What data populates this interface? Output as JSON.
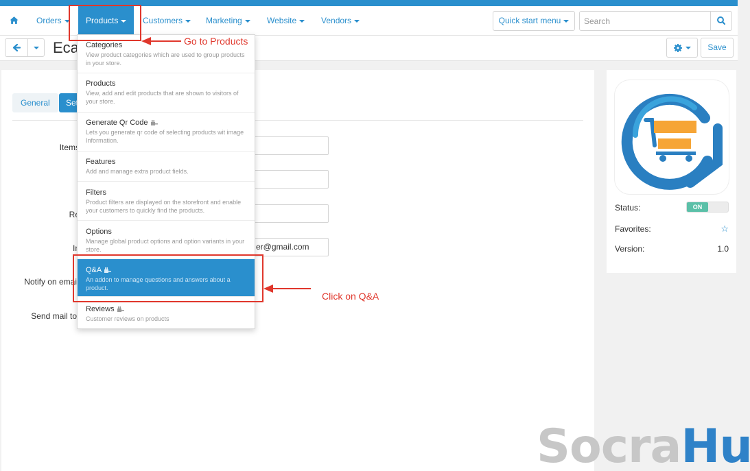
{
  "nav": {
    "items": [
      {
        "label": "Orders"
      },
      {
        "label": "Products"
      },
      {
        "label": "Customers"
      },
      {
        "label": "Marketing"
      },
      {
        "label": "Website"
      },
      {
        "label": "Vendors"
      }
    ],
    "quick_start_label": "Quick start menu",
    "search_placeholder": "Search"
  },
  "toolbar": {
    "title": "Eca",
    "save_label": "Save"
  },
  "tabs": [
    "General",
    "Set"
  ],
  "form": {
    "labels": [
      "Items",
      "Re",
      "In",
      "Notify on emai",
      "Send mail to"
    ],
    "email_value": "er@gmail.com"
  },
  "dropdown": {
    "items": [
      {
        "title": "Categories",
        "desc": "View product categories which are used to group products in your store.",
        "addon": false
      },
      {
        "title": "Products",
        "desc": "View, add and edit products that are shown to visitors of your store.",
        "addon": false
      },
      {
        "title": "Generate Qr Code",
        "desc": "Lets you generate qr code of selecting products wit image Information.",
        "addon": true
      },
      {
        "title": "Features",
        "desc": "Add and manage extra product fields.",
        "addon": false
      },
      {
        "title": "Filters",
        "desc": "Product filters are displayed on the storefront and enable your customers to quickly find the products.",
        "addon": false
      },
      {
        "title": "Options",
        "desc": "Manage global product options and option variants in your store.",
        "addon": false
      },
      {
        "title": "Q&A",
        "desc": "An addon to manage questions and answers about a product.",
        "addon": true,
        "highlighted": true
      },
      {
        "title": "Reviews",
        "desc": "Customer reviews on products",
        "addon": true
      }
    ]
  },
  "sidebar": {
    "status_label": "Status:",
    "status_value": "ON",
    "favorites_label": "Favorites:",
    "version_label": "Version:",
    "version_value": "1.0"
  },
  "annotations": {
    "go_to_products": "Go to Products",
    "click_qa": "Click on Q&A"
  },
  "watermark": {
    "part1": "Socra",
    "part2": "Hub"
  },
  "colors": {
    "accent": "#2a8fcd",
    "annotation": "#e0372c",
    "toggle_on": "#5bc0a8"
  }
}
